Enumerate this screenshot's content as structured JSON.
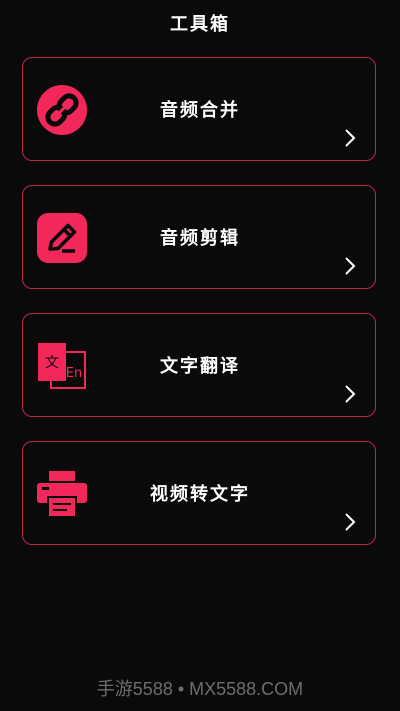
{
  "header": {
    "title": "工具箱"
  },
  "tools": [
    {
      "label": "音频合并",
      "icon": "link-icon"
    },
    {
      "label": "音频剪辑",
      "icon": "edit-pencil-icon"
    },
    {
      "label": "文字翻译",
      "icon": "translate-icon",
      "icon_text_cn": "文",
      "icon_text_en": "En"
    },
    {
      "label": "视频转文字",
      "icon": "printer-icon"
    }
  ],
  "footer": {
    "watermark": "手游5588 • MX5588.COM"
  },
  "colors": {
    "accent": "#f2285a",
    "border": "#b82a43",
    "background": "#0b0a0b"
  }
}
